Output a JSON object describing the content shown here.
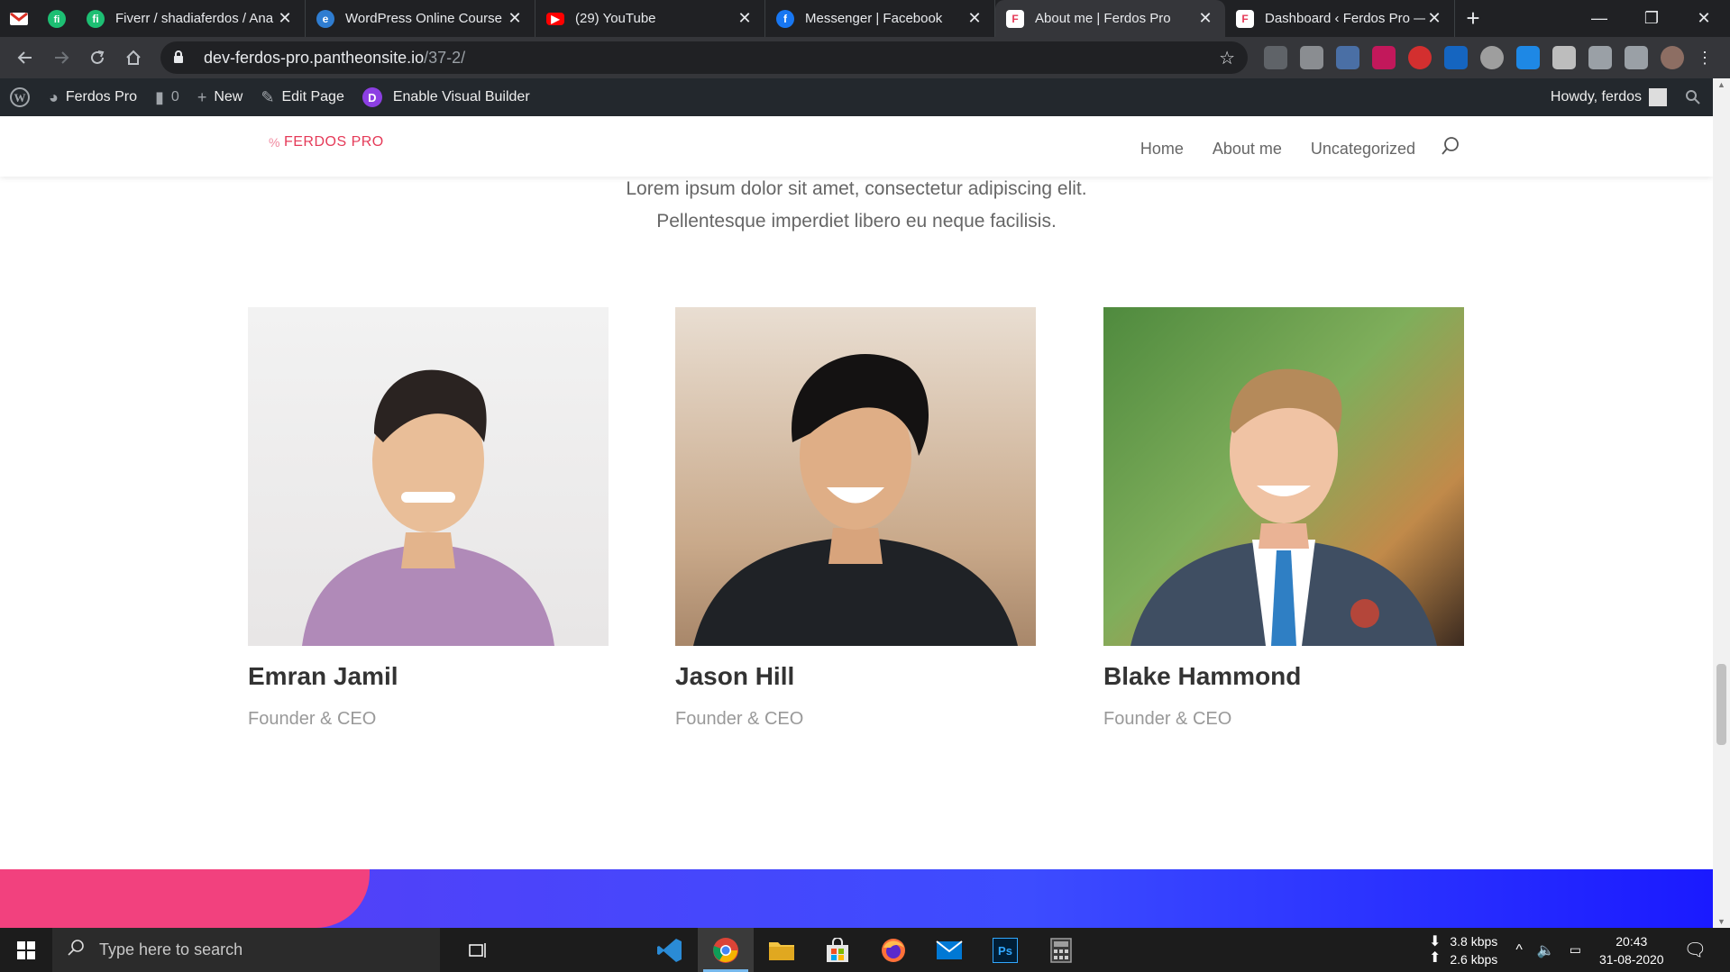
{
  "browser": {
    "tabs": [
      {
        "title": "Fiverr / shadiaferdos / Ana",
        "favicon_color": "#1dbf73",
        "favicon": "fiverr-icon"
      },
      {
        "title": "WordPress Online Course",
        "favicon_color": "#2f7dd1",
        "favicon": "wordpress-icon"
      },
      {
        "title": "(29) YouTube",
        "favicon_color": "#ff0000",
        "favicon": "youtube-icon"
      },
      {
        "title": "Messenger | Facebook",
        "favicon_color": "#1877f2",
        "favicon": "facebook-icon"
      },
      {
        "title": "About me | Ferdos Pro",
        "favicon_color": "#ffffff",
        "favicon": "site-icon",
        "active": true
      },
      {
        "title": "Dashboard ‹ Ferdos Pro —",
        "favicon_color": "#ffffff",
        "favicon": "site-icon"
      }
    ],
    "pinned": [
      {
        "icon": "gmail-icon"
      },
      {
        "icon": "fiverr-icon"
      }
    ],
    "close_glyph": "✕",
    "new_tab_glyph": "+",
    "window_controls": {
      "minimize": "—",
      "restore": "❐",
      "close": "✕"
    },
    "url_host": "dev-ferdos-pro.pantheonsite.io",
    "url_path": "/37-2/"
  },
  "wp_admin_bar": {
    "site_name": "Ferdos Pro",
    "comments_count": "0",
    "new_label": "New",
    "edit_label": "Edit Page",
    "builder_label": "Enable Visual Builder",
    "builder_badge": "D",
    "howdy": "Howdy, ferdos"
  },
  "site": {
    "logo_text": "FERDOS PRO",
    "nav": [
      "Home",
      "About me",
      "Uncategorized"
    ],
    "intro_line1": "Lorem ipsum dolor sit amet, consectetur adipiscing elit.",
    "intro_line2": "Pellentesque imperdiet libero eu neque facilisis.",
    "team": [
      {
        "name": "Emran Jamil",
        "role": "Founder & CEO"
      },
      {
        "name": "Jason Hill",
        "role": "Founder & CEO"
      },
      {
        "name": "Blake Hammond",
        "role": "Founder & CEO"
      }
    ]
  },
  "taskbar": {
    "search_placeholder": "Type here to search",
    "net_down": "3.8 kbps",
    "net_up": "2.6 kbps",
    "time": "20:43",
    "date": "31-08-2020"
  }
}
